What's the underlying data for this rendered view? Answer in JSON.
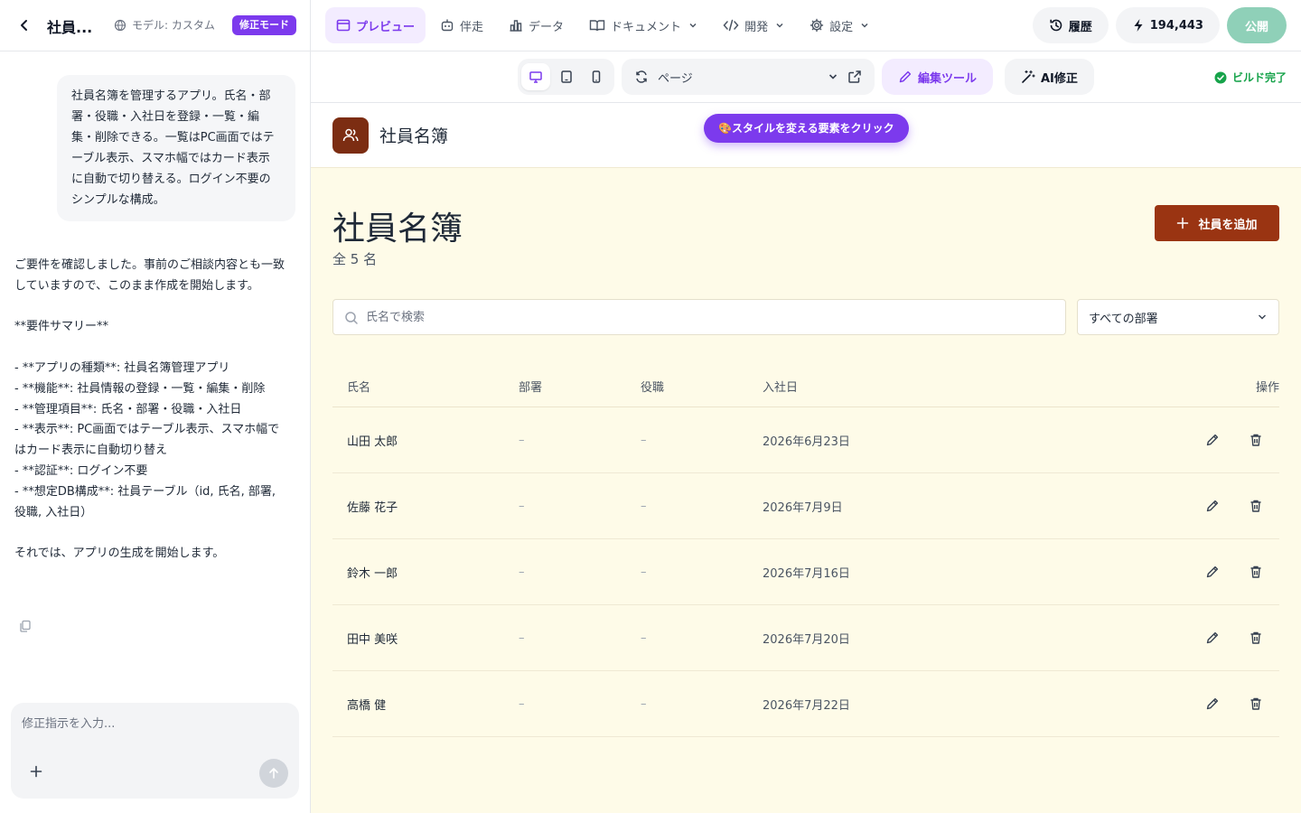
{
  "header": {
    "app_title": "社員...",
    "model_label": "モデル: カスタム",
    "mode_badge": "修正モード",
    "nav": [
      {
        "label": "プレビュー"
      },
      {
        "label": "伴走"
      },
      {
        "label": "データ"
      },
      {
        "label": "ドキュメント"
      },
      {
        "label": "開発"
      },
      {
        "label": "設定"
      }
    ],
    "history_label": "履歴",
    "credits": "194,443",
    "publish_label": "公開"
  },
  "chat": {
    "user_message": "社員名簿を管理するアプリ。氏名・部署・役職・入社日を登録・一覧・編集・削除できる。一覧はPC画面ではテーブル表示、スマホ幅ではカード表示に自動で切り替える。ログイン不要のシンプルな構成。",
    "assistant_message": "ご要件を確認しました。事前のご相談内容とも一致していますので、このまま作成を開始します。\n\n**要件サマリー**\n\n- **アプリの種類**: 社員名簿管理アプリ\n- **機能**: 社員情報の登録・一覧・編集・削除\n- **管理項目**: 氏名・部署・役職・入社日\n- **表示**: PC画面ではテーブル表示、スマホ幅ではカード表示に自動切り替え\n- **認証**: ログイン不要\n- **想定DB構成**: 社員テーブル（id, 氏名, 部署, 役職, 入社日）\n\nそれでは、アプリの生成を開始します。",
    "input_placeholder": "修正指示を入力..."
  },
  "toolbar": {
    "page_label": "ページ",
    "edit_tools": "編集ツール",
    "ai_fix": "AI修正",
    "build_status": "ビルド完了"
  },
  "preview": {
    "app_name": "社員名簿",
    "toast": "🎨スタイルを変える要素をクリック",
    "heading": "社員名簿",
    "count": "全 5 名",
    "add_button": "社員を追加",
    "search_placeholder": "氏名で検索",
    "dept_filter": "すべての部署",
    "columns": {
      "name": "氏名",
      "dept": "部署",
      "role": "役職",
      "date": "入社日",
      "ops": "操作"
    },
    "rows": [
      {
        "name": "山田 太郎",
        "dept": "–",
        "role": "–",
        "date": "2026年6月23日"
      },
      {
        "name": "佐藤 花子",
        "dept": "–",
        "role": "–",
        "date": "2026年7月9日"
      },
      {
        "name": "鈴木 一郎",
        "dept": "–",
        "role": "–",
        "date": "2026年7月16日"
      },
      {
        "name": "田中 美咲",
        "dept": "–",
        "role": "–",
        "date": "2026年7月20日"
      },
      {
        "name": "高橋 健",
        "dept": "–",
        "role": "–",
        "date": "2026年7月22日"
      }
    ]
  },
  "colors": {
    "accent": "#7c3aed",
    "brand": "#9a3412",
    "preview_bg": "#fefbe8",
    "success": "#16a34a"
  }
}
